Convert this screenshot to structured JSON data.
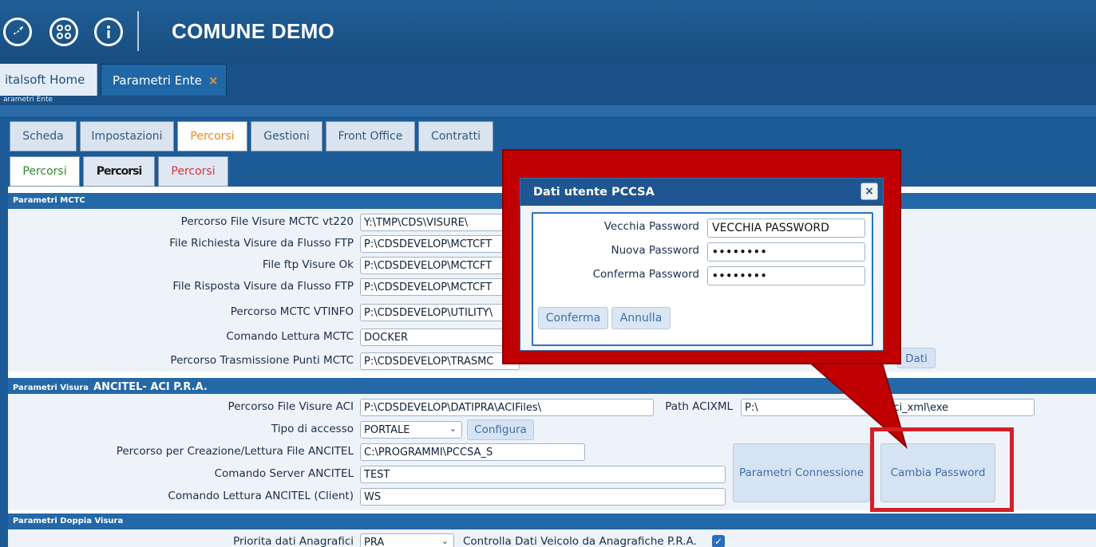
{
  "app": {
    "title": "COMUNE DEMO",
    "icons": [
      "rocket-icon",
      "grid-icon",
      "info-icon"
    ]
  },
  "window_tabs": [
    {
      "label": "italsoft Home"
    },
    {
      "label": "Parametri Ente",
      "close": "×"
    }
  ],
  "breadcrumb": "arametri Ente",
  "main_tabs": [
    "Scheda",
    "Impostazioni",
    "Percorsi",
    "Gestioni",
    "Front Office",
    "Contratti"
  ],
  "sub_tabs": [
    "Percorsi",
    "Percorsi",
    "Percorsi"
  ],
  "mctc": {
    "header": "Parametri MCTC",
    "rows": [
      {
        "label": "Percorso File Visure MCTC vt220",
        "value": "Y:\\TMP\\CDS\\VISURE\\"
      },
      {
        "label": "File Richiesta Visure da Flusso FTP",
        "value": "P:\\CDSDEVELOP\\MCTCFT"
      },
      {
        "label": "File ftp Visure Ok",
        "value": "P:\\CDSDEVELOP\\MCTCFT"
      },
      {
        "label": "File Risposta Visure da Flusso FTP",
        "value": "P:\\CDSDEVELOP\\MCTCFT"
      },
      {
        "label": "Percorso MCTC VTINFO",
        "value": "P:\\CDSDEVELOP\\UTILITY\\"
      },
      {
        "label": "Comando Lettura MCTC",
        "value": "DOCKER"
      },
      {
        "label": "Percorso Trasmissione Punti MCTC",
        "value": "P:\\CDSDEVELOP\\TRASMC"
      }
    ],
    "dati_button": "Dati"
  },
  "visura": {
    "header_small": "Parametri Visura",
    "header_big": "ANCITEL- ACI P.R.A.",
    "percorso_aci_label": "Percorso File Visure ACI",
    "percorso_aci_value": "P:\\CDSDEVELOP\\DATIPRA\\ACIFiles\\",
    "path_acixml_label": "Path ACIXML",
    "path_acixml_value_start": "P:\\",
    "path_acixml_value_end": "lity\\aci_xml\\exe",
    "tipo_accesso_label": "Tipo di accesso",
    "tipo_accesso_value": "PORTALE",
    "configura_button": "Configura",
    "creazione_label": "Percorso per Creazione/Lettura File ANCITEL",
    "creazione_value": "C:\\PROGRAMMI\\PCCSA_S",
    "server_label": "Comando Server ANCITEL",
    "server_value": "TEST",
    "client_label": "Comando Lettura ANCITEL (Client)",
    "client_value": "WS",
    "parametri_connessione_button": "Parametri Connessione",
    "cambia_password_button": "Cambia Password"
  },
  "doppia": {
    "header": "Parametri Doppia Visura",
    "priorita_label": "Priorita dati Anagrafici",
    "priorita_value": "PRA",
    "controlla_label": "Controlla Dati Veicolo da Anagrafiche P.R.A.",
    "controlla_checked": true
  },
  "dialog": {
    "title": "Dati utente PCCSA",
    "close": "×",
    "vecchia_label": "Vecchia Password",
    "vecchia_value": "VECCHIA PASSWORD",
    "nuova_label": "Nuova Password",
    "nuova_value": "••••••••",
    "conferma_label": "Conferma Password",
    "conferma_value": "••••••••",
    "confirm_button": "Conferma",
    "cancel_button": "Annulla"
  },
  "colors": {
    "topbar": "#1f5e95",
    "section_header": "#2468a8",
    "callout": "#c00000",
    "highlight": "#d41f26",
    "active_tab_text": "#e58a1f"
  }
}
